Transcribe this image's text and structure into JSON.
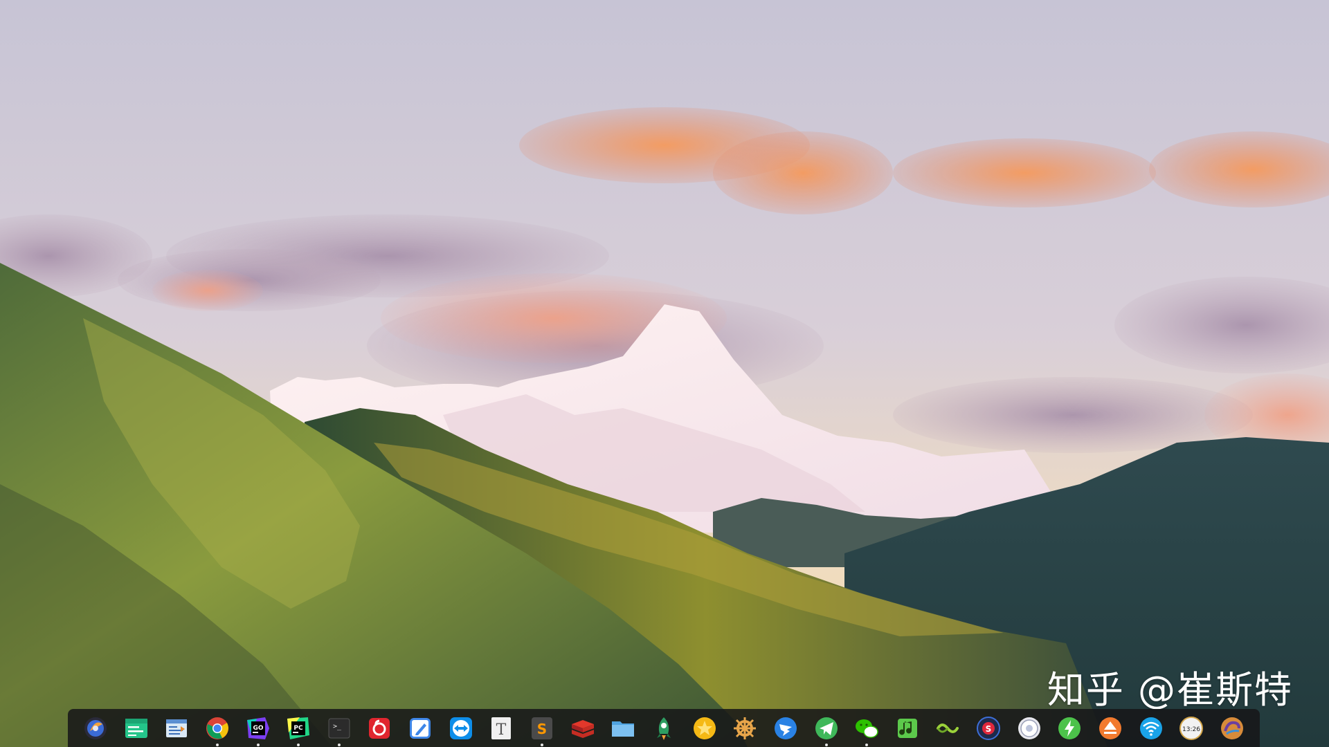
{
  "watermark": "知乎 @崔斯特",
  "dock": {
    "items": [
      {
        "name": "launcher-icon",
        "label": "Launcher"
      },
      {
        "name": "pycharm-folder-icon",
        "label": ""
      },
      {
        "name": "text-editor-icon",
        "label": ""
      },
      {
        "name": "chrome-icon",
        "label": ""
      },
      {
        "name": "goland-icon",
        "label": "GO"
      },
      {
        "name": "pycharm-icon",
        "label": "PC"
      },
      {
        "name": "terminal-icon",
        "label": ">_"
      },
      {
        "name": "netease-music-icon",
        "label": ""
      },
      {
        "name": "markdown-editor-icon",
        "label": ""
      },
      {
        "name": "teamviewer-icon",
        "label": ""
      },
      {
        "name": "typora-icon",
        "label": "T"
      },
      {
        "name": "sublime-text-icon",
        "label": "S"
      },
      {
        "name": "redis-icon",
        "label": ""
      },
      {
        "name": "file-manager-icon",
        "label": ""
      },
      {
        "name": "rocket-icon",
        "label": ""
      },
      {
        "name": "favorites-star-icon",
        "label": ""
      },
      {
        "name": "helm-wheel-icon",
        "label": ""
      },
      {
        "name": "dingtalk-icon",
        "label": ""
      },
      {
        "name": "telegram-icon",
        "label": ""
      },
      {
        "name": "wechat-icon",
        "label": ""
      },
      {
        "name": "music-player-icon",
        "label": ""
      },
      {
        "name": "vscode-like-icon",
        "label": ""
      },
      {
        "name": "screenshot-tool-icon",
        "label": "S"
      },
      {
        "name": "power-icon",
        "label": ""
      },
      {
        "name": "update-icon",
        "label": ""
      },
      {
        "name": "upload-icon",
        "label": ""
      },
      {
        "name": "wifi-icon",
        "label": ""
      },
      {
        "name": "clock-icon",
        "label": "13:26"
      },
      {
        "name": "trash-icon",
        "label": ""
      }
    ]
  },
  "colors": {
    "sky_top": "#c9c6d6",
    "sky_bottom": "#eed9b8",
    "cloud_orange": "#f39a5e",
    "cloud_purple": "#9e8ba8",
    "snow": "#f6e6ea",
    "grass": "#7b8d3a",
    "forest": "#2f4f3b",
    "dock_bg": "#161618"
  }
}
